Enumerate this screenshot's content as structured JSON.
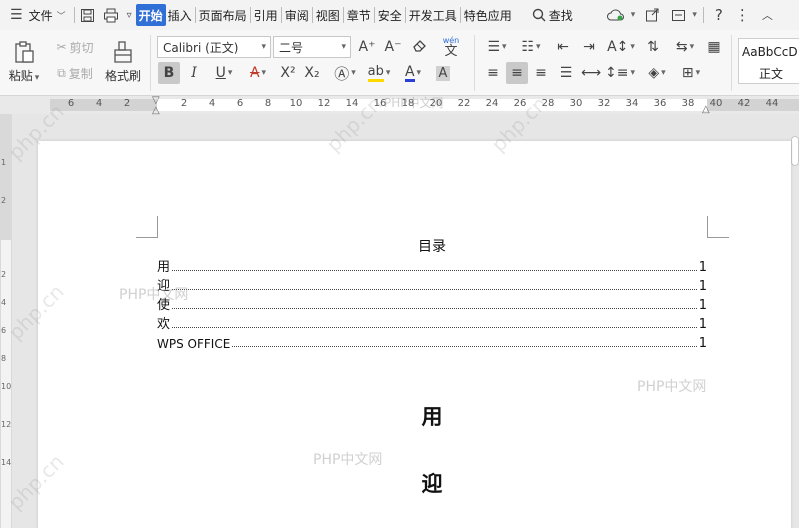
{
  "menubar": {
    "menu_label": "文件",
    "tabs": [
      "开始",
      "插入",
      "页面布局",
      "引用",
      "审阅",
      "视图",
      "章节",
      "安全",
      "开发工具",
      "特色应用"
    ],
    "active_tab": "开始",
    "search_label": "查找"
  },
  "ribbon": {
    "paste": "粘贴",
    "cut": "剪切",
    "copy": "复制",
    "format_painter": "格式刷",
    "font_name": "Calibri (正文)",
    "font_size": "二号",
    "style_preview": "AaBbCcD",
    "style_name": "正文",
    "phonetic": "wén",
    "phonetic_char": "文"
  },
  "ruler": {
    "left_numbers": [
      "6",
      "4",
      "2"
    ],
    "right_numbers": [
      "2",
      "4",
      "6",
      "8",
      "10",
      "12",
      "14",
      "16",
      "18",
      "20",
      "22",
      "24",
      "26",
      "28",
      "30",
      "32",
      "34",
      "36",
      "38",
      "40",
      "42",
      "44"
    ]
  },
  "vruler": {
    "numbers": [
      "1",
      "2",
      "2",
      "4",
      "6",
      "8",
      "10",
      "12",
      "14"
    ]
  },
  "document": {
    "toc_title": "目录",
    "toc_entries": [
      {
        "text": "用",
        "page": "1"
      },
      {
        "text": "迎",
        "page": "1"
      },
      {
        "text": "使",
        "page": "1"
      },
      {
        "text": "欢",
        "page": "1"
      },
      {
        "text": "WPS OFFICE",
        "page": "1"
      }
    ],
    "headings": [
      "用",
      "迎"
    ]
  },
  "watermark": "PHP中文网",
  "watermark_diag": "php.cn"
}
